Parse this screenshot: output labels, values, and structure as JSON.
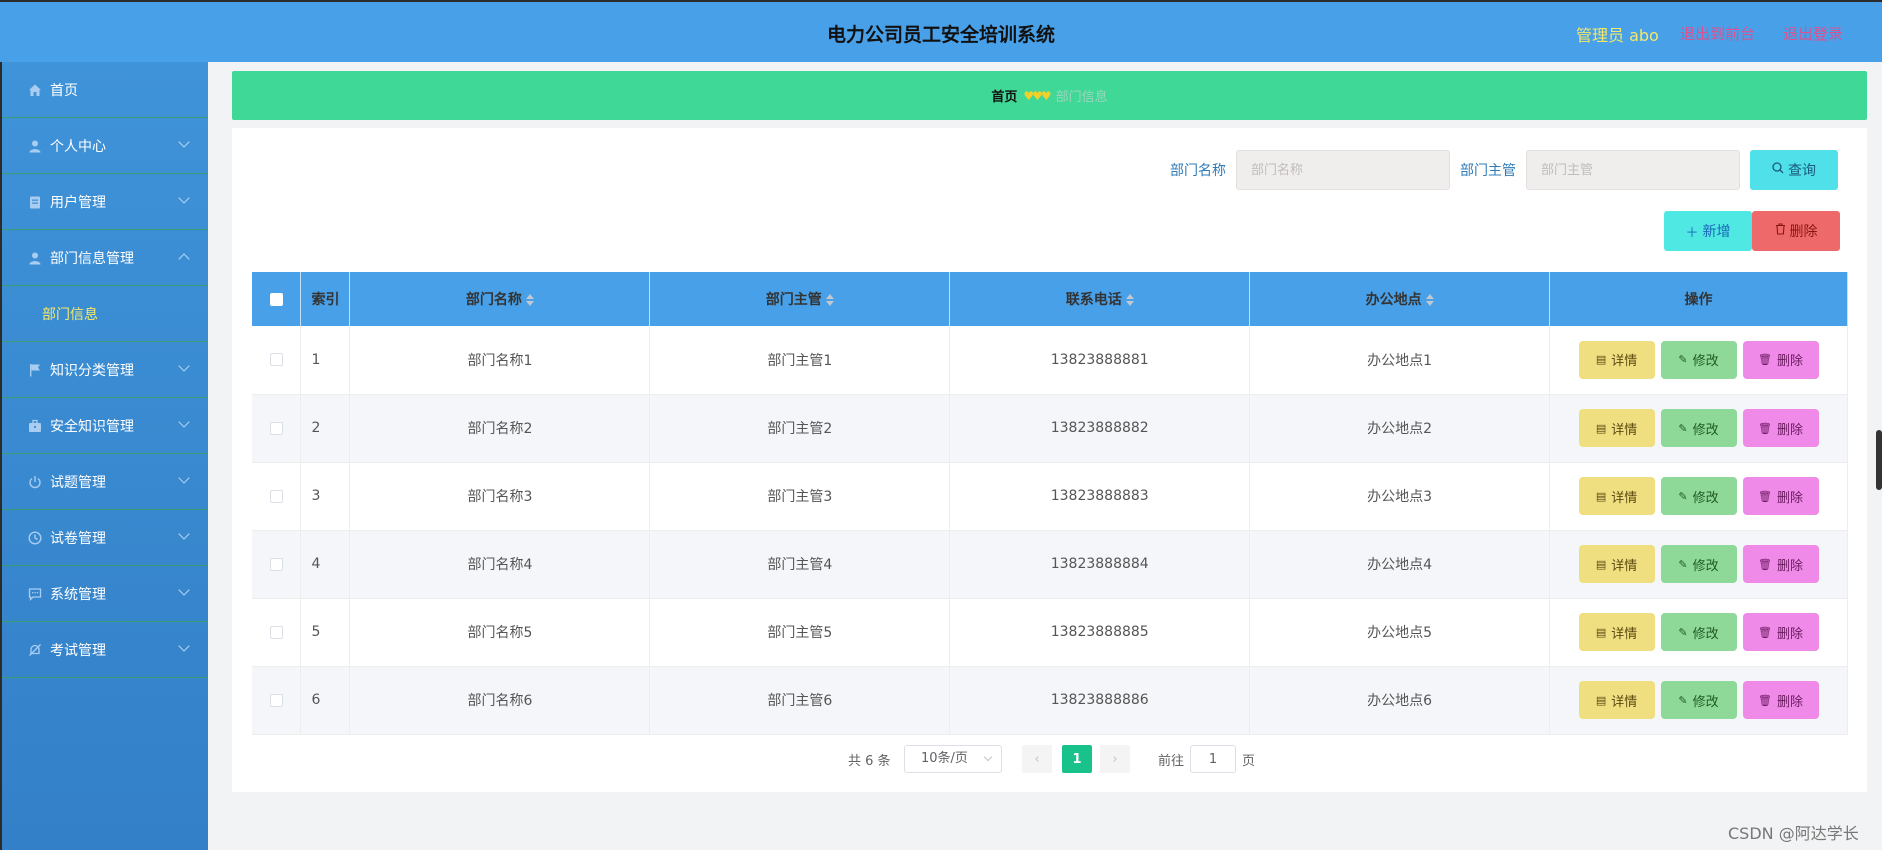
{
  "header": {
    "title": "电力公司员工安全培训系统",
    "user": "管理员 abo",
    "to_frontend": "退出到前台",
    "logout": "退出登录"
  },
  "sidebar": {
    "items": [
      {
        "label": "首页",
        "icon": "home-icon",
        "has_children": false
      },
      {
        "label": "个人中心",
        "icon": "user-icon",
        "has_children": true
      },
      {
        "label": "用户管理",
        "icon": "clipboard-icon",
        "has_children": true
      },
      {
        "label": "部门信息管理",
        "icon": "user-icon",
        "has_children": true,
        "expanded": true,
        "children": [
          "部门信息"
        ]
      },
      {
        "label": "知识分类管理",
        "icon": "flag-icon",
        "has_children": true
      },
      {
        "label": "安全知识管理",
        "icon": "briefcase-icon",
        "has_children": true
      },
      {
        "label": "试题管理",
        "icon": "power-icon",
        "has_children": true
      },
      {
        "label": "试卷管理",
        "icon": "clock-icon",
        "has_children": true
      },
      {
        "label": "系统管理",
        "icon": "chat-icon",
        "has_children": true
      },
      {
        "label": "考试管理",
        "icon": "bell-off-icon",
        "has_children": true
      }
    ]
  },
  "breadcrumb": {
    "home": "首页",
    "separator": "♥♥♥",
    "current": "部门信息"
  },
  "search": {
    "dept_name_label": "部门名称",
    "dept_name_placeholder": "部门名称",
    "dept_head_label": "部门主管",
    "dept_head_placeholder": "部门主管",
    "query_button": "查询"
  },
  "actions": {
    "add_button": "新增",
    "delete_button": "删除"
  },
  "table": {
    "columns": [
      "索引",
      "部门名称",
      "部门主管",
      "联系电话",
      "办公地点",
      "操作"
    ],
    "rows": [
      {
        "index": "1",
        "dept_name": "部门名称1",
        "dept_head": "部门主管1",
        "phone": "13823888881",
        "location": "办公地点1"
      },
      {
        "index": "2",
        "dept_name": "部门名称2",
        "dept_head": "部门主管2",
        "phone": "13823888882",
        "location": "办公地点2"
      },
      {
        "index": "3",
        "dept_name": "部门名称3",
        "dept_head": "部门主管3",
        "phone": "13823888883",
        "location": "办公地点3"
      },
      {
        "index": "4",
        "dept_name": "部门名称4",
        "dept_head": "部门主管4",
        "phone": "13823888884",
        "location": "办公地点4"
      },
      {
        "index": "5",
        "dept_name": "部门名称5",
        "dept_head": "部门主管5",
        "phone": "13823888885",
        "location": "办公地点5"
      },
      {
        "index": "6",
        "dept_name": "部门名称6",
        "dept_head": "部门主管6",
        "phone": "13823888886",
        "location": "办公地点6"
      }
    ],
    "row_actions": {
      "detail": "详情",
      "edit": "修改",
      "remove": "删除"
    }
  },
  "pagination": {
    "total": "共 6 条",
    "page_size": "10条/页",
    "current_page": "1",
    "goto_label": "前往",
    "goto_value": "1",
    "page_suffix": "页"
  },
  "watermark": "CSDN @阿达学长",
  "colors": {
    "header": "#48a0e8",
    "sidebar": "#3f93d8",
    "breadcrumb": "#3fd896",
    "active_page": "#19c28a"
  }
}
